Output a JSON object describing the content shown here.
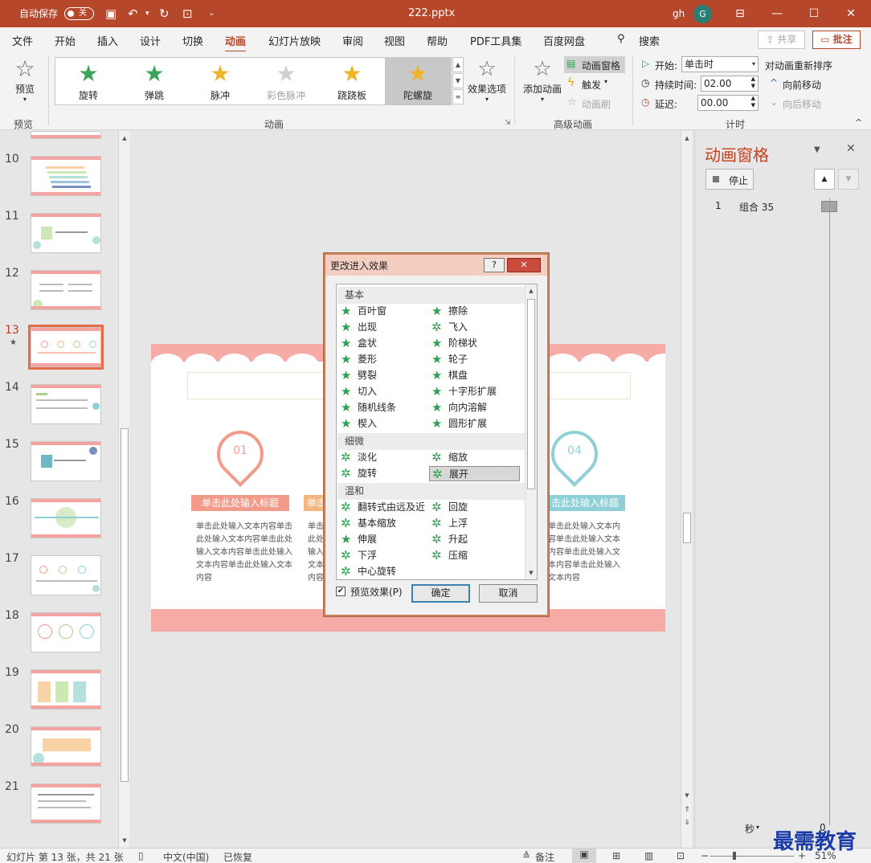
{
  "titlebar": {
    "autosave_label": "自动保存",
    "autosave_state": "关",
    "filename": "222.pptx",
    "user_initials": "gh",
    "avatar_letter": "G"
  },
  "tabs": [
    "文件",
    "开始",
    "插入",
    "设计",
    "切换",
    "动画",
    "幻灯片放映",
    "审阅",
    "视图",
    "帮助",
    "PDF工具集",
    "百度网盘"
  ],
  "search_label": "搜索",
  "share_label": "共享",
  "comment_label": "批注",
  "ribbon": {
    "preview_label": "预览",
    "preview_group": "预览",
    "animation_group": "动画",
    "advanced_group": "高级动画",
    "timing_group": "计时",
    "gallery": [
      {
        "label": "旋转",
        "color": "#3aa357"
      },
      {
        "label": "弹跳",
        "color": "#3aa357"
      },
      {
        "label": "脉冲",
        "color": "#f0b429"
      },
      {
        "label": "彩色脉冲",
        "color": "#c8c8c8"
      },
      {
        "label": "跷跷板",
        "color": "#f0b429"
      },
      {
        "label": "陀螺旋",
        "color": "#f0b429"
      }
    ],
    "effect_options": "效果选项",
    "add_animation": "添加动画",
    "animation_pane": "动画窗格",
    "trigger": "触发",
    "animation_painter": "动画刷",
    "start_label": "开始:",
    "start_value": "单击时",
    "duration_label": "持续时间:",
    "duration_value": "02.00",
    "delay_label": "延迟:",
    "delay_value": "00.00",
    "reorder_label": "对动画重新排序",
    "move_earlier": "向前移动",
    "move_later": "向后移动"
  },
  "thumbnails": [
    "10",
    "11",
    "12",
    "13",
    "14",
    "15",
    "16",
    "17",
    "18",
    "19",
    "20",
    "21"
  ],
  "current_slide": "13",
  "slide": {
    "pin1": "01",
    "pin4": "04",
    "header1": "单击此处输入标题",
    "header3": "单击",
    "header4": "击此处输入标题",
    "body": "单击此处输入文本内容单击此处输入文本内容单击此处输入文本内容单击此处输入文本内容单击此处输入文本内容",
    "body_partial": "单击此处输入文本内容单击此处输入文本内容单击此处输入文本内容单击此处输入文本内容"
  },
  "anim_pane": {
    "title": "动画窗格",
    "stop_label": "停止",
    "item_index": "1",
    "item_name": "组合 35",
    "seconds_label": "秒",
    "zero": "0"
  },
  "dialog": {
    "title": "更改进入效果",
    "help": "?",
    "close": "✕",
    "categories": [
      "基本",
      "细微",
      "温和"
    ],
    "basic": [
      "百叶窗",
      "擦除",
      "出现",
      "飞入",
      "盒状",
      "阶梯状",
      "菱形",
      "轮子",
      "劈裂",
      "棋盘",
      "切入",
      "十字形扩展",
      "随机线条",
      "向内溶解",
      "楔入",
      "圆形扩展"
    ],
    "subtle": [
      "淡化",
      "缩放",
      "旋转",
      "展开"
    ],
    "moderate": [
      "翻转式由远及近",
      "回旋",
      "基本缩放",
      "上浮",
      "伸展",
      "升起",
      "下浮",
      "压缩",
      "中心旋转"
    ],
    "preview_label": "预览效果(P)",
    "ok_label": "确定",
    "cancel_label": "取消"
  },
  "status": {
    "slide_info": "幻灯片 第 13 张，共 21 张",
    "language": "中文(中国)",
    "recovered": "已恢复",
    "notes": "备注",
    "zoom": "51%"
  },
  "watermark": "最需教育"
}
